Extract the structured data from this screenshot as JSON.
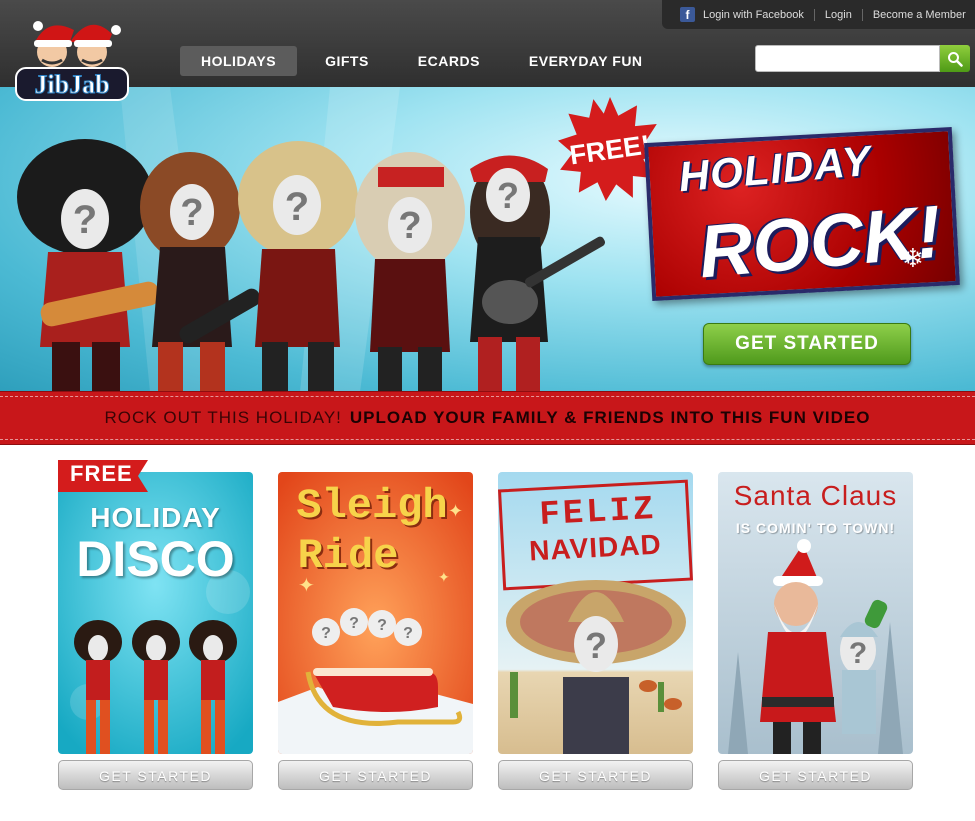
{
  "brand": {
    "logo_text": "JibJab"
  },
  "topbar": {
    "facebook_login": "Login with Facebook",
    "login": "Login",
    "become_member": "Become a Member"
  },
  "nav": {
    "items": [
      "HOLIDAYS",
      "GIFTS",
      "ECARDS",
      "EVERYDAY FUN"
    ],
    "active": "HOLIDAYS"
  },
  "search": {
    "value": "",
    "placeholder": ""
  },
  "hero": {
    "badge": "FREE!",
    "title_line1": "HOLIDAY",
    "title_line2": "ROCK!",
    "cta": "GET STARTED"
  },
  "ribbon": {
    "lead": "ROCK OUT THIS HOLIDAY!",
    "main": "UPLOAD YOUR FAMILY & FRIENDS INTO THIS FUN VIDEO"
  },
  "cards": [
    {
      "badge": "FREE",
      "title_line1": "HOLIDAY",
      "title_line2": "DISCO",
      "cta": "GET STARTED"
    },
    {
      "title_line1": "Sleigh",
      "title_line2": "Ride",
      "cta": "GET STARTED"
    },
    {
      "title_line1": "FELIZ",
      "title_line2": "NAVIDAD",
      "cta": "GET STARTED"
    },
    {
      "title_line1": "Santa Claus",
      "title_line2": "IS COMIN' TO TOWN!",
      "cta": "GET STARTED"
    }
  ],
  "colors": {
    "header": "#3a3a3a",
    "ribbon": "#c8171a",
    "cta_green": "#5fae26",
    "search_green": "#6ab52a"
  },
  "icons": [
    "facebook-icon",
    "search-icon",
    "snowflake-icon"
  ]
}
